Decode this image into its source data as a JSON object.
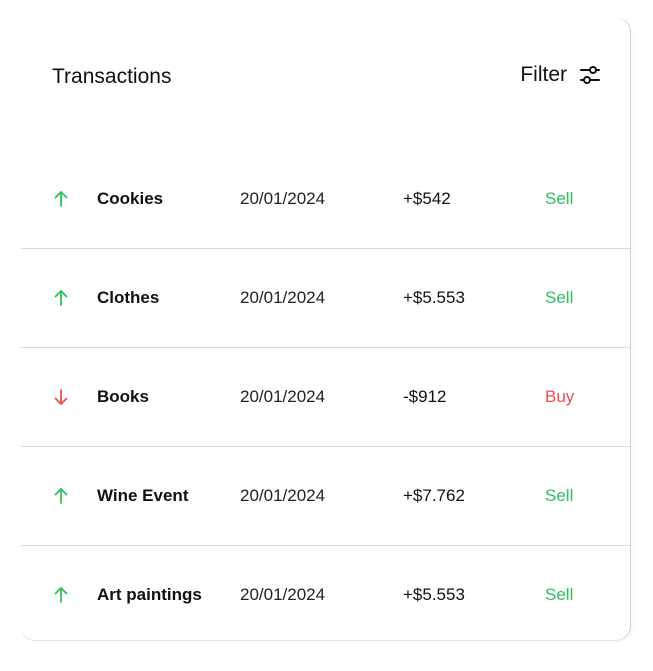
{
  "header": {
    "title": "Transactions",
    "filter_label": "Filter",
    "filter_icon": "sliders-icon"
  },
  "colors": {
    "up": "#2fbf5a",
    "down": "#f04e4e",
    "text": "#111111",
    "divider": "#d9d9d9"
  },
  "transactions": [
    {
      "direction": "up",
      "icon": "arrow-up-icon",
      "name": "Cookies",
      "date": "20/01/2024",
      "amount": "+$542",
      "type": "Sell"
    },
    {
      "direction": "up",
      "icon": "arrow-up-icon",
      "name": "Clothes",
      "date": "20/01/2024",
      "amount": "+$5.553",
      "type": "Sell"
    },
    {
      "direction": "down",
      "icon": "arrow-down-icon",
      "name": "Books",
      "date": "20/01/2024",
      "amount": "-$912",
      "type": "Buy"
    },
    {
      "direction": "up",
      "icon": "arrow-up-icon",
      "name": "Wine Event",
      "date": "20/01/2024",
      "amount": "+$7.762",
      "type": "Sell"
    },
    {
      "direction": "up",
      "icon": "arrow-up-icon",
      "name": "Art paintings",
      "date": "20/01/2024",
      "amount": "+$5.553",
      "type": "Sell"
    }
  ]
}
